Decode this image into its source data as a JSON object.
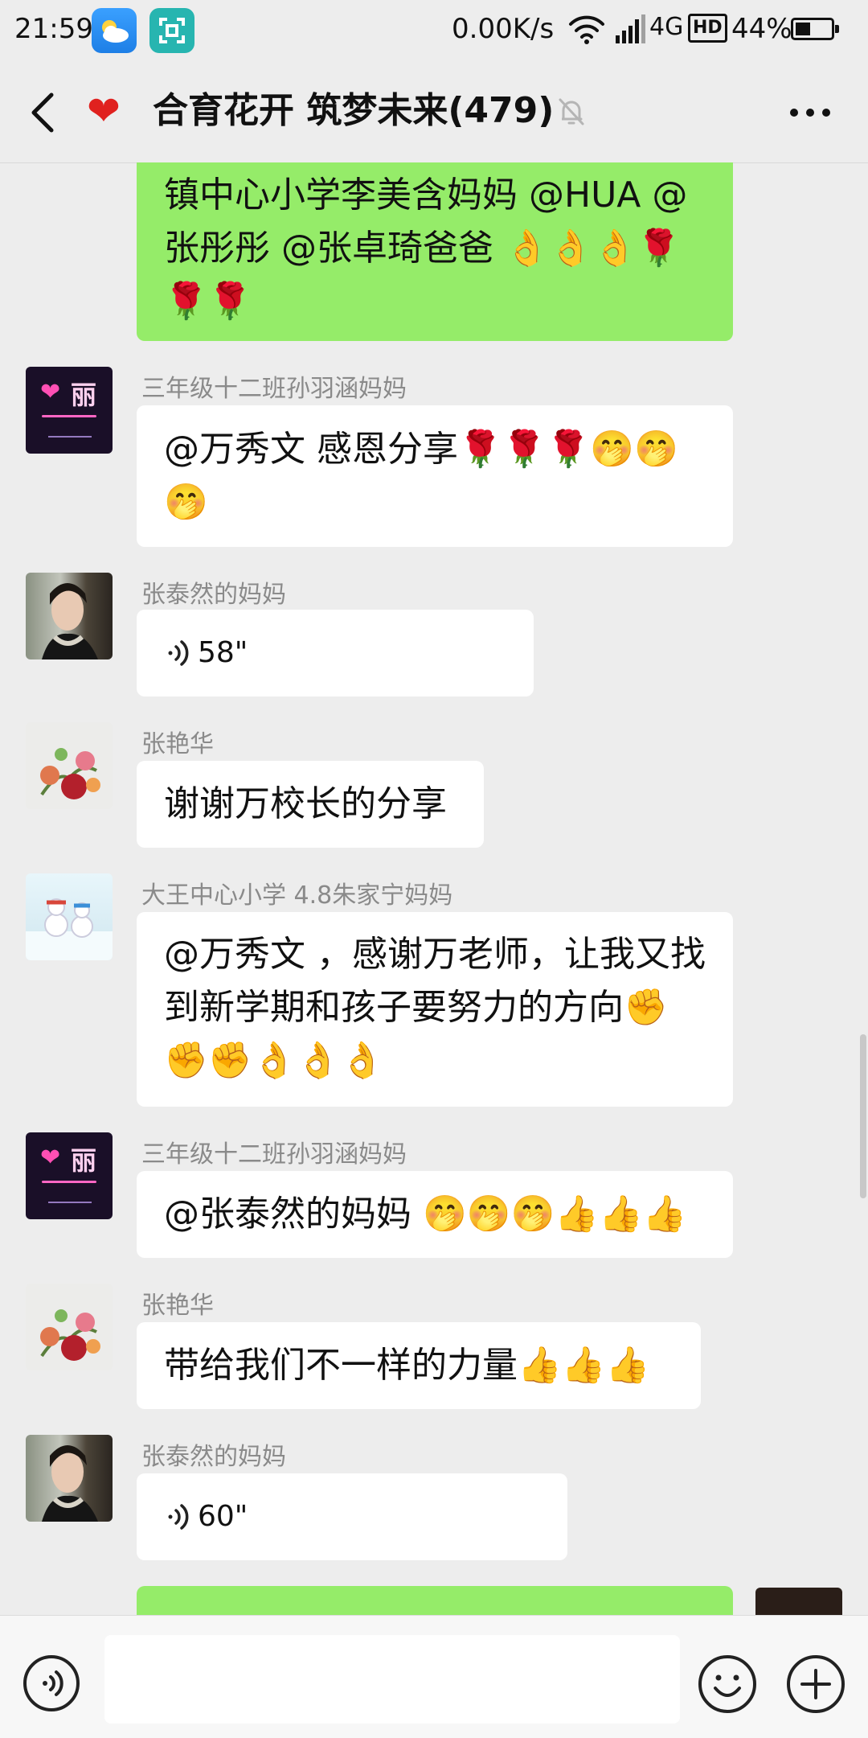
{
  "status_bar": {
    "time": "21:59",
    "net_speed": "0.00K/s",
    "network": "4G",
    "hd": "HD",
    "battery": "44%",
    "battery_level": 0.44
  },
  "header": {
    "title": "合育花开 筑梦未来(479)"
  },
  "messages": [
    {
      "type": "text",
      "mine": true,
      "text": "镇中心小学李美含妈妈 @HUA @张彤彤 @张卓琦爸爸 👌👌👌🌹🌹🌹"
    },
    {
      "type": "text",
      "sender": "三年级十二班孙羽涵妈妈",
      "text": "@万秀文  感恩分享🌹🌹🌹🤭🤭🤭"
    },
    {
      "type": "voice",
      "sender": "张泰然的妈妈",
      "duration": "58\""
    },
    {
      "type": "text",
      "sender": "张艳华",
      "text": "谢谢万校长的分享"
    },
    {
      "type": "text",
      "sender": "大王中心小学 4.8朱家宁妈妈",
      "text": "@万秀文 ，感谢万老师，让我又找到新学期和孩子要努力的方向✊✊✊👌👌👌"
    },
    {
      "type": "text",
      "sender": "三年级十二班孙羽涵妈妈",
      "text": "@张泰然的妈妈  🤭🤭🤭👍👍👍"
    },
    {
      "type": "text",
      "sender": "张艳华",
      "text": "带给我们不一样的力量👍👍👍"
    },
    {
      "type": "voice",
      "sender": "张泰然的妈妈",
      "duration": "60\""
    }
  ],
  "icons": {
    "weather": "weather-icon",
    "scan": "scan-icon",
    "back": "back-arrow-icon",
    "heart": "heart-icon",
    "mute": "mute-bell-icon",
    "more": "more-dots-icon",
    "voice": "voice-input-icon",
    "emoji": "emoji-icon",
    "plus": "plus-icon"
  },
  "colors": {
    "background": "#ededed",
    "my_bubble": "#95ec69",
    "other_bubble": "#ffffff",
    "sender_name": "#8a8a8a",
    "heart": "#e0211f"
  }
}
